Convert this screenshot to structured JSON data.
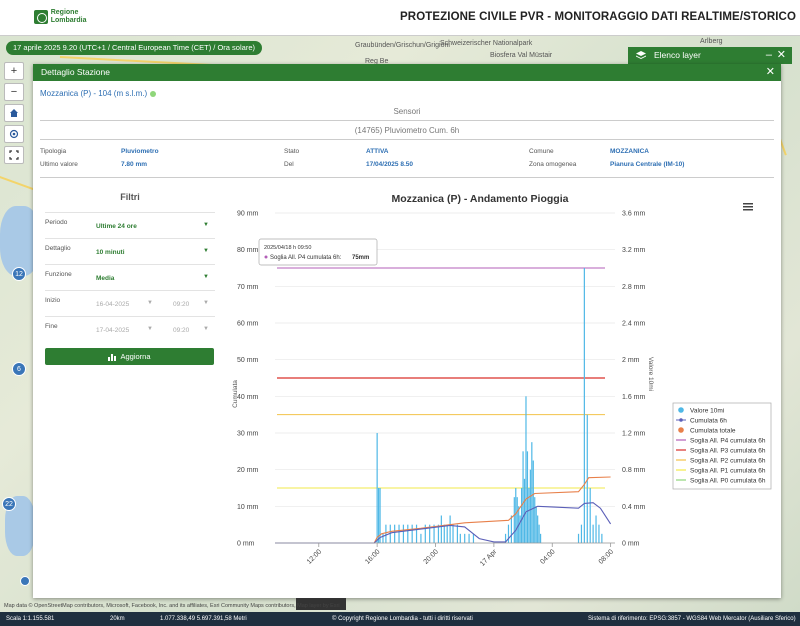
{
  "header": {
    "logo_text": "Regione Lombardia",
    "title": "PROTEZIONE CIVILE PVR - MONITORAGGIO DATI REALTIME/STORICO"
  },
  "time_pill": "17 aprile 2025 9.20 (UTC+1 / Central European Time (CET) / Ora solare)",
  "map_labels": [
    "Graubünden/Grischun/Grigioni",
    "Schweizerischer Nationalpark",
    "Biosfera Val Müstair",
    "Reg Be",
    "Arlberg"
  ],
  "markers": [
    {
      "label": "12",
      "color": "#3a76b8"
    },
    {
      "label": "6",
      "color": "#3a76b8"
    },
    {
      "label": "22",
      "color": "#3a76b8"
    }
  ],
  "layer_panel": {
    "title": "Elenco layer",
    "min_label": "–",
    "close_label": "✕"
  },
  "dialog": {
    "title": "Dettaglio Stazione",
    "close_label": "✕",
    "station": "Mozzanica (P) - 104 (m s.l.m.)",
    "sensors_title": "Sensori",
    "sensor_id": "(14765) Pluviometro Cum. 6h",
    "info": [
      {
        "k": "Tipologia",
        "v": "Pluviometro"
      },
      {
        "k": "Ultimo valore",
        "v": "7.80 mm"
      },
      {
        "k": "Stato",
        "v": "ATTIVA"
      },
      {
        "k": "Del",
        "v": "17/04/2025 8.50"
      },
      {
        "k": "Comune",
        "v": "MOZZANICA"
      },
      {
        "k": "Zona omogenea",
        "v": "Pianura Centrale (IM-10)"
      }
    ]
  },
  "filters": {
    "title": "Filtri",
    "periodo_label": "Periodo",
    "periodo_value": "Ultime 24 ore",
    "dettaglio_label": "Dettaglio",
    "dettaglio_value": "10 minuti",
    "funzione_label": "Funzione",
    "funzione_value": "Media",
    "inizio_label": "Inizio",
    "inizio_date": "16-04-2025",
    "inizio_time": "09:20",
    "fine_label": "Fine",
    "fine_date": "17-04-2025",
    "fine_time": "09:20",
    "refresh_label": "Aggiorna"
  },
  "chart_data": {
    "type": "bar",
    "title": "Mozzanica (P) - Andamento Pioggia",
    "ylabel_left": "Cumulata",
    "ylabel_right": "Valore 10mi",
    "y_left_ticks": [
      "0 mm",
      "10 mm",
      "20 mm",
      "30 mm",
      "40 mm",
      "50 mm",
      "60 mm",
      "70 mm",
      "80 mm",
      "90 mm"
    ],
    "y_right_ticks": [
      "0 mm",
      "0.4 mm",
      "0.8 mm",
      "1.2 mm",
      "1.6 mm",
      "2 mm",
      "2.4 mm",
      "2.8 mm",
      "3.2 mm",
      "3.6 mm"
    ],
    "ylim_left": [
      0,
      90
    ],
    "ylim_right": [
      0,
      3.6
    ],
    "x_ticks": [
      "12:00",
      "16:00",
      "20:00",
      "17 Apr",
      "04:00",
      "08:00"
    ],
    "tooltip_time": "2025/04/18 h 09:50",
    "tooltip_series": "Soglia All. P4 cumulata 6h:",
    "tooltip_value": "75mm",
    "legend": [
      {
        "name": "Valore 10mi",
        "color": "#4fb8e6",
        "kind": "dot"
      },
      {
        "name": "Cumulata 6h",
        "color": "#5b5fb8",
        "kind": "line-dot"
      },
      {
        "name": "Cumulata totale",
        "color": "#e8804a",
        "kind": "dot"
      },
      {
        "name": "Soglia All. P4 cumulata 6h",
        "color": "#b35fb8",
        "kind": "line"
      },
      {
        "name": "Soglia All. P3 cumulata 6h",
        "color": "#d9302a",
        "kind": "line"
      },
      {
        "name": "Soglia All. P2 cumulata 6h",
        "color": "#f2c24a",
        "kind": "line"
      },
      {
        "name": "Soglia All. P1 cumulata 6h",
        "color": "#f2e84a",
        "kind": "line"
      },
      {
        "name": "Soglia All. P0 cumulata 6h",
        "color": "#8fd67a",
        "kind": "line"
      }
    ],
    "thresholds": [
      {
        "name": "P4",
        "value": 75,
        "color": "#b35fb8"
      },
      {
        "name": "P3",
        "value": 45,
        "color": "#d9302a"
      },
      {
        "name": "P2",
        "value": 35,
        "color": "#f2c24a"
      },
      {
        "name": "P1",
        "value": 15,
        "color": "#f2e84a"
      }
    ],
    "bars_right_axis": [
      [
        16.0,
        1.2
      ],
      [
        16.1,
        0.6
      ],
      [
        16.2,
        0.6
      ],
      [
        16.4,
        0.1
      ],
      [
        16.6,
        0.2
      ],
      [
        16.9,
        0.2
      ],
      [
        17.2,
        0.2
      ],
      [
        17.5,
        0.2
      ],
      [
        17.8,
        0.2
      ],
      [
        18.1,
        0.2
      ],
      [
        18.4,
        0.2
      ],
      [
        18.7,
        0.2
      ],
      [
        19.0,
        0.1
      ],
      [
        19.3,
        0.2
      ],
      [
        19.6,
        0.2
      ],
      [
        19.9,
        0.2
      ],
      [
        20.2,
        0.2
      ],
      [
        20.4,
        0.3
      ],
      [
        20.6,
        0.2
      ],
      [
        20.8,
        0.2
      ],
      [
        21.0,
        0.3
      ],
      [
        21.2,
        0.2
      ],
      [
        21.5,
        0.2
      ],
      [
        21.7,
        0.1
      ],
      [
        22.0,
        0.1
      ],
      [
        22.3,
        0.1
      ],
      [
        22.6,
        0.1
      ],
      [
        24.8,
        0.1
      ],
      [
        25.0,
        0.2
      ],
      [
        25.2,
        0.3
      ],
      [
        25.4,
        0.5
      ],
      [
        25.5,
        0.6
      ],
      [
        25.6,
        0.5
      ],
      [
        25.7,
        0.4
      ],
      [
        25.8,
        0.3
      ],
      [
        25.9,
        0.6
      ],
      [
        26.0,
        1.0
      ],
      [
        26.1,
        0.7
      ],
      [
        26.2,
        1.6
      ],
      [
        26.3,
        1.0
      ],
      [
        26.4,
        0.6
      ],
      [
        26.5,
        0.8
      ],
      [
        26.6,
        1.1
      ],
      [
        26.7,
        0.9
      ],
      [
        26.8,
        0.5
      ],
      [
        26.9,
        0.4
      ],
      [
        27.0,
        0.3
      ],
      [
        27.1,
        0.2
      ],
      [
        27.2,
        0.1
      ],
      [
        29.8,
        0.1
      ],
      [
        30.0,
        0.2
      ],
      [
        30.2,
        3.0
      ],
      [
        30.4,
        1.4
      ],
      [
        30.6,
        0.6
      ],
      [
        30.8,
        0.2
      ],
      [
        31.0,
        0.3
      ],
      [
        31.2,
        0.2
      ],
      [
        31.4,
        0.1
      ]
    ],
    "cumulata_totale": [
      [
        9,
        0
      ],
      [
        15.8,
        0
      ],
      [
        16.0,
        1.5
      ],
      [
        16.3,
        2.5
      ],
      [
        17.0,
        3.2
      ],
      [
        19.0,
        4.0
      ],
      [
        22.0,
        5.5
      ],
      [
        25.0,
        6.2
      ],
      [
        25.5,
        8.0
      ],
      [
        26.2,
        12.0
      ],
      [
        26.8,
        13.5
      ],
      [
        29.8,
        14.0
      ],
      [
        30.2,
        16.0
      ],
      [
        30.5,
        17.8
      ],
      [
        32,
        18.0
      ]
    ],
    "cumulata_6h": [
      [
        9,
        0
      ],
      [
        15.8,
        0
      ],
      [
        16.2,
        1.5
      ],
      [
        17.0,
        2.8
      ],
      [
        19.0,
        3.8
      ],
      [
        21.0,
        4.8
      ],
      [
        22.0,
        4.4
      ],
      [
        23.0,
        1.2
      ],
      [
        24.0,
        0.3
      ],
      [
        24.8,
        0.3
      ],
      [
        25.5,
        3.5
      ],
      [
        26.2,
        8.5
      ],
      [
        27.0,
        10.0
      ],
      [
        29.8,
        9.5
      ],
      [
        30.2,
        10.8
      ],
      [
        30.8,
        11.0
      ],
      [
        31.3,
        9.5
      ],
      [
        32,
        5.2
      ]
    ],
    "x_range_hours": [
      9,
      32.3
    ],
    "x_tick_hours": [
      12,
      16,
      20,
      24,
      28,
      32
    ]
  },
  "bottom": {
    "attribution": "Map data © OpenStreetMap contributors, Microsoft, Facebook, Inc. and its affiliates, Esri Community Maps contributors, Map layer by Esri",
    "scale": "Scala 1:1.155.581",
    "scale_bar": "20km",
    "coords": "1.077.338,49 5.697.391,58 Metri",
    "copyright": "© Copyright Regione Lombardia - tutti i diritti riservati",
    "crs": "Sistema di riferimento: EPSG:3857 - WGS84 Web Mercator (Ausiliare Sferico)"
  }
}
